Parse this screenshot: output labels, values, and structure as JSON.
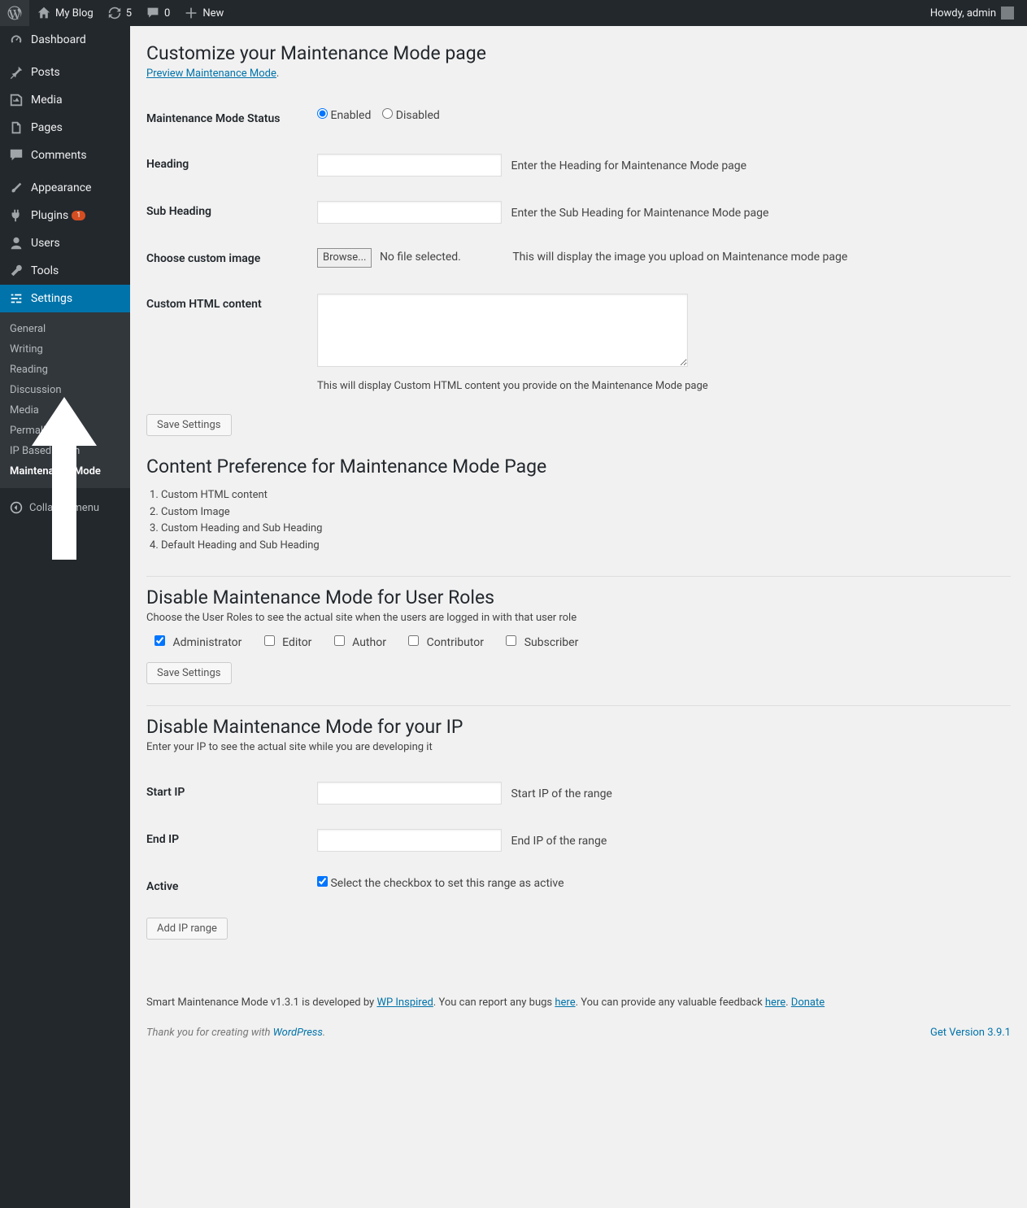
{
  "adminbar": {
    "site_name": "My Blog",
    "updates_count": "5",
    "comments_count": "0",
    "new_label": "New",
    "howdy": "Howdy, admin"
  },
  "sidebar": {
    "items": [
      {
        "label": "Dashboard"
      },
      {
        "label": "Posts"
      },
      {
        "label": "Media"
      },
      {
        "label": "Pages"
      },
      {
        "label": "Comments"
      },
      {
        "label": "Appearance"
      },
      {
        "label": "Plugins",
        "badge": "1"
      },
      {
        "label": "Users"
      },
      {
        "label": "Tools"
      },
      {
        "label": "Settings"
      }
    ],
    "submenu": [
      "General",
      "Writing",
      "Reading",
      "Discussion",
      "Media",
      "Permalinks",
      "IP Based Login",
      "Maintenance Mode"
    ],
    "collapse": "Collapse menu"
  },
  "page": {
    "title": "Customize your Maintenance Mode page",
    "preview_link": "Preview Maintenance Mode",
    "status_label": "Maintenance Mode Status",
    "status_enabled": "Enabled",
    "status_disabled": "Disabled",
    "heading_label": "Heading",
    "heading_hint": "Enter the Heading for Maintenance Mode page",
    "subheading_label": "Sub Heading",
    "subheading_hint": "Enter the Sub Heading for Maintenance Mode page",
    "custom_image_label": "Choose custom image",
    "browse": "Browse...",
    "nofile": "No file selected.",
    "custom_image_hint": "This will display the image you upload on Maintenance mode page",
    "custom_html_label": "Custom HTML content",
    "custom_html_hint": "This will display Custom HTML content you provide on the Maintenance Mode page",
    "save": "Save Settings",
    "cp_title": "Content Preference for Maintenance Mode Page",
    "cp_list": [
      "Custom HTML content",
      "Custom Image",
      "Custom Heading and Sub Heading",
      "Default Heading and Sub Heading"
    ],
    "roles_title": "Disable Maintenance Mode for User Roles",
    "roles_sub": "Choose the User Roles to see the actual site when the users are logged in with that user role",
    "roles": [
      "Administrator",
      "Editor",
      "Author",
      "Contributor",
      "Subscriber"
    ],
    "ip_title": "Disable Maintenance Mode for your IP",
    "ip_sub": "Enter your IP to see the actual site while you are developing it",
    "start_ip_label": "Start IP",
    "start_ip_hint": "Start IP of the range",
    "end_ip_label": "End IP",
    "end_ip_hint": "End IP of the range",
    "active_label": "Active",
    "active_hint": "Select the checkbox to set this range as active",
    "add_ip": "Add IP range"
  },
  "footer": {
    "line1_a": "Smart Maintenance Mode v1.3.1 is developed by ",
    "wp_inspired": "WP Inspired",
    "line1_b": ". You can report any bugs ",
    "here1": "here",
    "line1_c": ". You can provide any valuable feedback ",
    "here2": "here",
    "line1_d": ". ",
    "donate": "Donate",
    "thank": "Thank you for creating with ",
    "wordpress": "WordPress",
    "version": "Get Version 3.9.1"
  }
}
